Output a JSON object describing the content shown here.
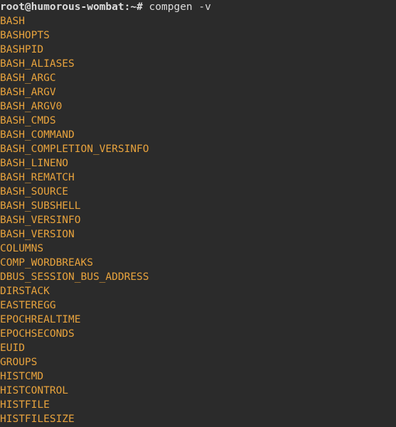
{
  "prompt": {
    "user_host": "root@humorous-wombat",
    "sep": ":",
    "path": "~",
    "symbol": "#",
    "command": "compgen -v"
  },
  "output": [
    "BASH",
    "BASHOPTS",
    "BASHPID",
    "BASH_ALIASES",
    "BASH_ARGC",
    "BASH_ARGV",
    "BASH_ARGV0",
    "BASH_CMDS",
    "BASH_COMMAND",
    "BASH_COMPLETION_VERSINFO",
    "BASH_LINENO",
    "BASH_REMATCH",
    "BASH_SOURCE",
    "BASH_SUBSHELL",
    "BASH_VERSINFO",
    "BASH_VERSION",
    "COLUMNS",
    "COMP_WORDBREAKS",
    "DBUS_SESSION_BUS_ADDRESS",
    "DIRSTACK",
    "EASTEREGG",
    "EPOCHREALTIME",
    "EPOCHSECONDS",
    "EUID",
    "GROUPS",
    "HISTCMD",
    "HISTCONTROL",
    "HISTFILE",
    "HISTFILESIZE"
  ]
}
